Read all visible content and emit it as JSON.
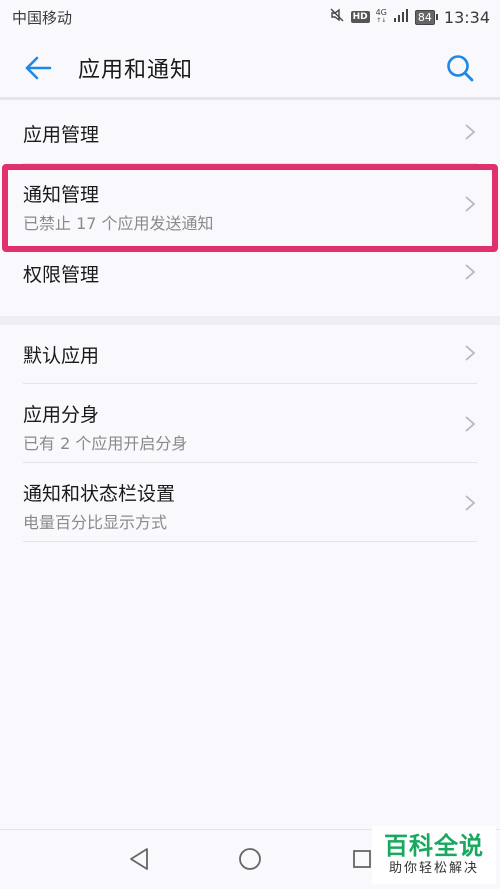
{
  "status_bar": {
    "carrier": "中国移动",
    "hd": "HD",
    "net_type": "4G",
    "battery": "84",
    "time": "13:34"
  },
  "header": {
    "title": "应用和通知",
    "back_icon": "arrow-left-icon",
    "search_icon": "search-icon",
    "accent_color": "#1e88e5"
  },
  "list_group_1": {
    "items": [
      {
        "title": "应用管理",
        "subtitle": ""
      },
      {
        "title": "通知管理",
        "subtitle": "已禁止 17 个应用发送通知"
      },
      {
        "title": "权限管理",
        "subtitle": ""
      }
    ]
  },
  "list_group_2": {
    "items": [
      {
        "title": "默认应用",
        "subtitle": ""
      },
      {
        "title": "应用分身",
        "subtitle": "已有 2 个应用开启分身"
      },
      {
        "title": "通知和状态栏设置",
        "subtitle": "电量百分比显示方式"
      }
    ]
  },
  "highlight": {
    "color": "#e0306e",
    "target": "通知管理"
  },
  "nav_bar": {
    "back_icon": "triangle-back-icon",
    "home_icon": "circle-home-icon",
    "recent_icon": "square-recent-icon"
  },
  "watermark": {
    "title": "百科全说",
    "subtitle": "助你轻松解决"
  }
}
